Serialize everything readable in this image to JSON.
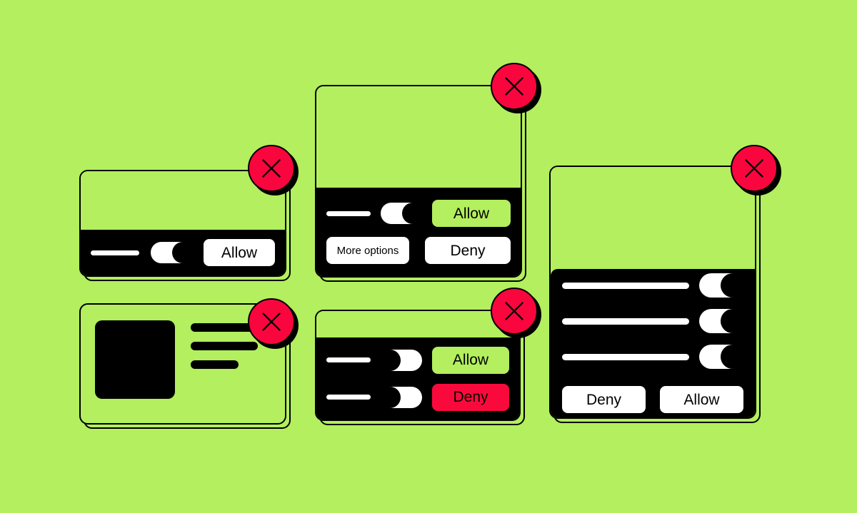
{
  "page": {
    "background_color": "#b3ef5e",
    "accent_green": "#b3ef5e",
    "accent_red": "#fa0a3c",
    "badge_red": "#f8063d",
    "panel_black": "#000000",
    "surface_white": "#ffffff"
  },
  "close_badge": {
    "icon": "close-x-icon"
  },
  "cards": {
    "permission_single": {
      "toggle": {
        "icon": "toggle-switch-icon",
        "state": "on"
      },
      "allow_label": "Allow"
    },
    "permission_more_options": {
      "toggle": {
        "icon": "toggle-switch-icon",
        "state": "on"
      },
      "allow_label": "Allow",
      "more_options_label": "More options",
      "deny_label": "Deny"
    },
    "media_preview": {
      "thumbnail": "image-placeholder",
      "lines": [
        "line-1",
        "line-2",
        "line-3"
      ]
    },
    "permission_dual": {
      "rows": [
        {
          "toggle": {
            "icon": "toggle-switch-icon",
            "state": "off"
          },
          "action_label": "Allow",
          "action_style": "green"
        },
        {
          "toggle": {
            "icon": "toggle-switch-icon",
            "state": "off"
          },
          "action_label": "Deny",
          "action_style": "red"
        }
      ]
    },
    "permission_list": {
      "rows": [
        {
          "toggle": {
            "icon": "toggle-switch-icon",
            "state": "on"
          }
        },
        {
          "toggle": {
            "icon": "toggle-switch-icon",
            "state": "on"
          }
        },
        {
          "toggle": {
            "icon": "toggle-switch-icon",
            "state": "on"
          }
        }
      ],
      "deny_label": "Deny",
      "allow_label": "Allow"
    }
  }
}
